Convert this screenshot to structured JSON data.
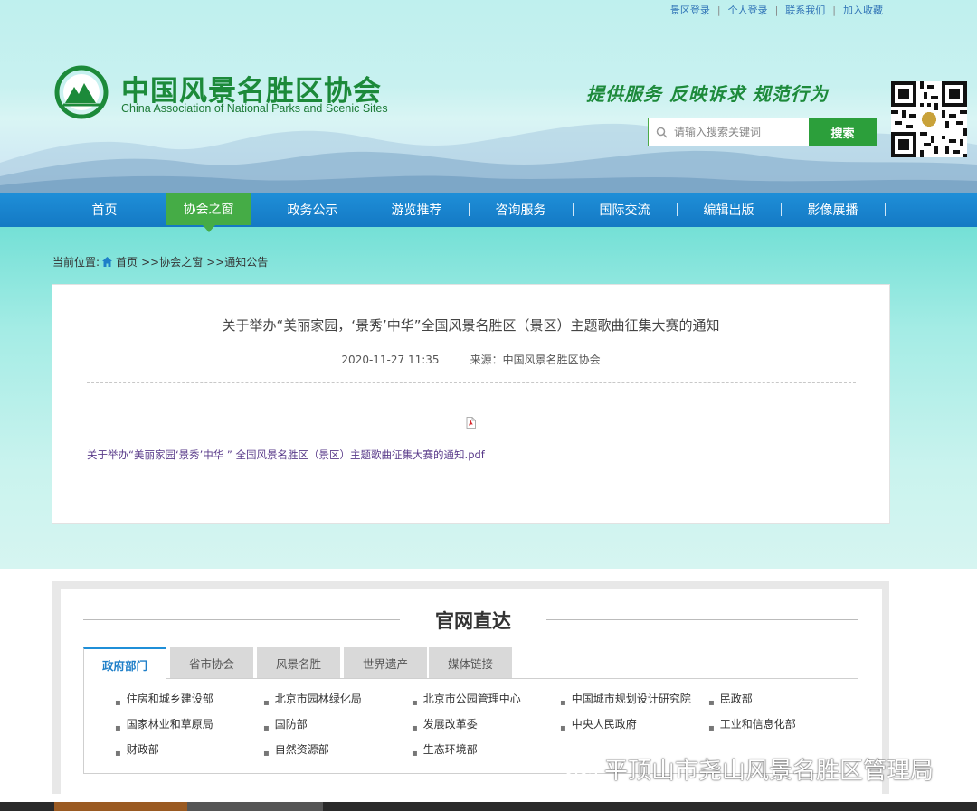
{
  "top_links": [
    "景区登录",
    "个人登录",
    "联系我们",
    "加入收藏"
  ],
  "site": {
    "title": "中国风景名胜区协会",
    "subtitle": "China Association of National Parks and Scenic Sites",
    "slogan": "提供服务  反映诉求  规范行为"
  },
  "search": {
    "placeholder": "请输入搜索关键词",
    "button": "搜索"
  },
  "nav": {
    "items": [
      "首页",
      "协会之窗",
      "政务公示",
      "游览推荐",
      "咨询服务",
      "国际交流",
      "编辑出版",
      "影像展播"
    ],
    "active": "协会之窗"
  },
  "breadcrumb": {
    "label": "当前位置:",
    "home": "首页",
    "level1": ">>协会之窗",
    "level2": ">>通知公告"
  },
  "article": {
    "title": "关于举办“美丽家园，‘景秀’中华”全国风景名胜区（景区）主题歌曲征集大赛的通知",
    "date": "2020-11-27 11:35",
    "source": "来源：中国风景名胜区协会",
    "attachment": "关于举办“美丽家园‘景秀’中华 ” 全国风景名胜区（景区）主题歌曲征集大赛的通知.pdf"
  },
  "links_section": {
    "title": "官网直达",
    "tabs": [
      "政府部门",
      "省市协会",
      "风景名胜",
      "世界遗产",
      "媒体链接"
    ],
    "active_tab": "政府部门",
    "items": [
      "住房和城乡建设部",
      "北京市园林绿化局",
      "北京市公园管理中心",
      "中国城市规划设计研究院",
      "民政部",
      "国家林业和草原局",
      "国防部",
      "发展改革委",
      "中央人民政府",
      "工业和信息化部",
      "财政部",
      "自然资源部",
      "生态环境部"
    ]
  },
  "watermark": "平顶山市尧山风景名胜区管理局",
  "colors": {
    "brand_green": "#1c8a3a",
    "nav_blue": "#1479c4",
    "active_green": "#45ac46"
  }
}
